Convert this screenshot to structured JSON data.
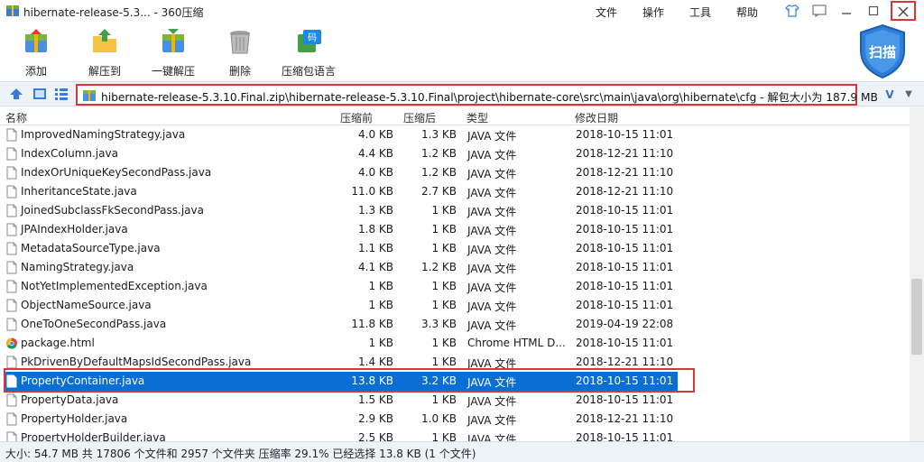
{
  "window": {
    "title": "hibernate-release-5.3... - 360压缩",
    "menus": [
      "文件",
      "操作",
      "工具",
      "帮助"
    ]
  },
  "toolbar": {
    "buttons": [
      {
        "label": "添加",
        "icon": "add-archive-icon"
      },
      {
        "label": "解压到",
        "icon": "extract-to-icon"
      },
      {
        "label": "一键解压",
        "icon": "one-click-extract-icon"
      },
      {
        "label": "删除",
        "icon": "delete-trash-icon"
      },
      {
        "label": "压缩包语言",
        "icon": "archive-language-icon"
      }
    ],
    "scan_label": "扫描"
  },
  "address": {
    "path": "hibernate-release-5.3.10.Final.zip\\hibernate-release-5.3.10.Final\\project\\hibernate-core\\src\\main\\java\\org\\hibernate\\cfg - 解包大小为 187.9 MB",
    "dropdown": "V"
  },
  "columns": {
    "name": "名称",
    "packed": "压缩前",
    "size": "压缩后",
    "type": "类型",
    "modified": "修改日期"
  },
  "files": [
    {
      "name": "ImprovedNamingStrategy.java",
      "before": "4.0 KB",
      "after": "1.3 KB",
      "type": "JAVA 文件",
      "date": "2018-10-15 11:01",
      "icon": "file"
    },
    {
      "name": "IndexColumn.java",
      "before": "4.4 KB",
      "after": "1.2 KB",
      "type": "JAVA 文件",
      "date": "2018-12-21 11:10",
      "icon": "file"
    },
    {
      "name": "IndexOrUniqueKeySecondPass.java",
      "before": "4.0 KB",
      "after": "1.2 KB",
      "type": "JAVA 文件",
      "date": "2018-12-21 11:10",
      "icon": "file"
    },
    {
      "name": "InheritanceState.java",
      "before": "11.0 KB",
      "after": "2.7 KB",
      "type": "JAVA 文件",
      "date": "2018-12-21 11:10",
      "icon": "file"
    },
    {
      "name": "JoinedSubclassFkSecondPass.java",
      "before": "1.3 KB",
      "after": "1 KB",
      "type": "JAVA 文件",
      "date": "2018-10-15 11:01",
      "icon": "file"
    },
    {
      "name": "JPAIndexHolder.java",
      "before": "1.8 KB",
      "after": "1 KB",
      "type": "JAVA 文件",
      "date": "2018-10-15 11:01",
      "icon": "file"
    },
    {
      "name": "MetadataSourceType.java",
      "before": "1.1 KB",
      "after": "1 KB",
      "type": "JAVA 文件",
      "date": "2018-10-15 11:01",
      "icon": "file"
    },
    {
      "name": "NamingStrategy.java",
      "before": "4.1 KB",
      "after": "1.2 KB",
      "type": "JAVA 文件",
      "date": "2018-10-15 11:01",
      "icon": "file"
    },
    {
      "name": "NotYetImplementedException.java",
      "before": "1 KB",
      "after": "1 KB",
      "type": "JAVA 文件",
      "date": "2018-10-15 11:01",
      "icon": "file"
    },
    {
      "name": "ObjectNameSource.java",
      "before": "1 KB",
      "after": "1 KB",
      "type": "JAVA 文件",
      "date": "2018-10-15 11:01",
      "icon": "file"
    },
    {
      "name": "OneToOneSecondPass.java",
      "before": "11.8 KB",
      "after": "3.3 KB",
      "type": "JAVA 文件",
      "date": "2019-04-19 22:08",
      "icon": "file"
    },
    {
      "name": "package.html",
      "before": "1 KB",
      "after": "1 KB",
      "type": "Chrome HTML D...",
      "date": "2018-10-15 11:01",
      "icon": "chrome"
    },
    {
      "name": "PkDrivenByDefaultMapsIdSecondPass.java",
      "before": "1.4 KB",
      "after": "1 KB",
      "type": "JAVA 文件",
      "date": "2018-12-21 11:10",
      "icon": "file"
    },
    {
      "name": "PropertyContainer.java",
      "before": "13.8 KB",
      "after": "3.2 KB",
      "type": "JAVA 文件",
      "date": "2018-10-15 11:01",
      "icon": "file",
      "selected": true
    },
    {
      "name": "PropertyData.java",
      "before": "1.5 KB",
      "after": "1 KB",
      "type": "JAVA 文件",
      "date": "2018-10-15 11:01",
      "icon": "file"
    },
    {
      "name": "PropertyHolder.java",
      "before": "2.9 KB",
      "after": "1.0 KB",
      "type": "JAVA 文件",
      "date": "2018-12-21 11:10",
      "icon": "file"
    },
    {
      "name": "PropertyHolderBuilder.java",
      "before": "2.5 KB",
      "after": "1 KB",
      "type": "JAVA 文件",
      "date": "2018-10-15 11:01",
      "icon": "file"
    }
  ],
  "status": "大小: 54.7 MB 共 17806 个文件和 2957 个文件夹 压缩率 29.1% 已经选择 13.8 KB (1 个文件)",
  "colors": {
    "selection": "#0a6fd4",
    "highlight_frame": "#d93737",
    "chrome_bar": "#eef3f9"
  }
}
